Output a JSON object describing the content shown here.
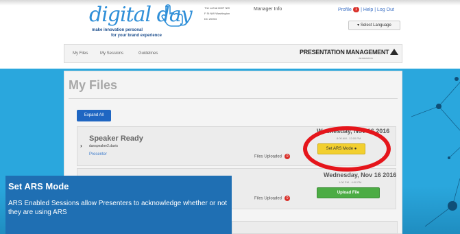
{
  "header": {
    "logo_main": "digital day",
    "logo_tagline_1": "make innovation personal",
    "logo_tagline_2": "for your brand experience",
    "address_line_1": "The Loft at 600F NW",
    "address_line_2": "F St NW Washington",
    "address_line_3": "DC 20004",
    "manager_info": "Manager Info",
    "profile_link": "Profile",
    "profile_badge": "1",
    "help_link": "Help",
    "logout_link": "Log Out",
    "separator": "|",
    "language_button": "Select Language"
  },
  "nav": {
    "items": [
      "My Files",
      "My Sessions",
      "Guidelines"
    ],
    "brand": "PRESENTATION MANAGEMENT",
    "brand_sub": "INFORMATION"
  },
  "main": {
    "page_title": "My Files",
    "expand_all": "Expand All",
    "sessions": [
      {
        "name": "Speaker Ready",
        "user": "danspeaker2.davis",
        "role": "Presenter",
        "files_uploaded_label": "Files Uploaded",
        "files_uploaded_count": "0",
        "date": "Wednesday, Nov 16 2016",
        "time": "8:00 AM - 12:00 PM",
        "action_label": "Set ARS Mode"
      },
      {
        "files_uploaded_label": "Files Uploaded",
        "files_uploaded_count": "0",
        "date": "Wednesday, Nov 16 2016",
        "time": "1:00 PM - 4:00 PM",
        "action_label": "Upload File"
      }
    ]
  },
  "callout": {
    "title": "Set ARS Mode",
    "body": "ARS Enabled Sessions allow Presenters to acknowledge whether or not they are using ARS"
  },
  "colors": {
    "blue_band": "#2aa7dd",
    "callout_bg": "#1f6fb3",
    "ars_button": "#f2cf2f",
    "upload_button": "#4cac44",
    "highlight_ring": "#e5151b",
    "badge": "#d9302a"
  }
}
